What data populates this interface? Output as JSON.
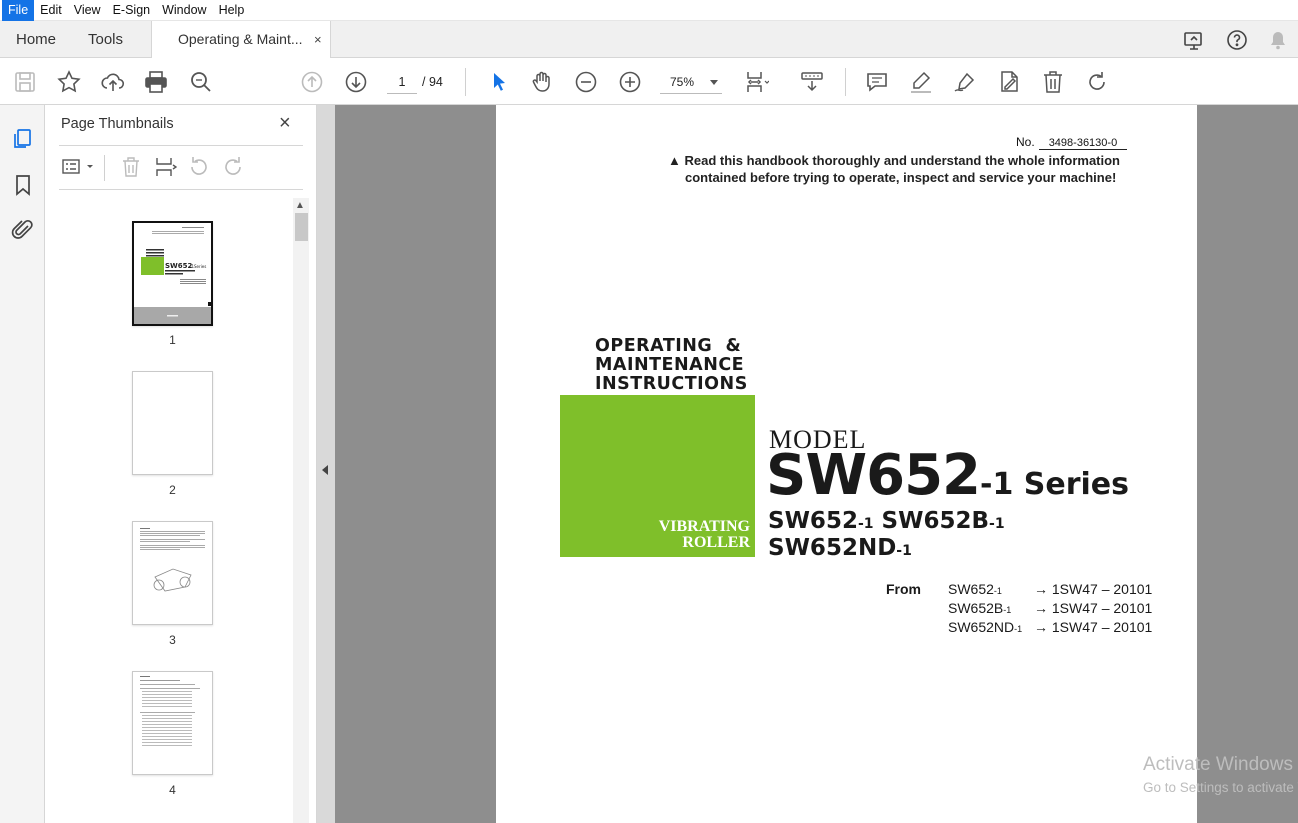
{
  "menu": {
    "items": [
      "File",
      "Edit",
      "View",
      "E-Sign",
      "Window",
      "Help"
    ]
  },
  "tabs": {
    "home": "Home",
    "tools": "Tools",
    "document": "Operating & Maint...",
    "close": "×"
  },
  "toolbar": {
    "current_page": "1",
    "page_of": "/  94",
    "zoom": "75%"
  },
  "panel": {
    "title": "Page Thumbnails",
    "close": "×",
    "thumbnails": [
      {
        "label": "1"
      },
      {
        "label": "2"
      },
      {
        "label": "3"
      },
      {
        "label": "4"
      }
    ]
  },
  "document": {
    "no_label": "No.",
    "no_value": "3498-36130-0",
    "warning_line1": "Read this handbook thoroughly and understand the whole information",
    "warning_line2": "contained before trying to operate, inspect and service your machine!",
    "heading_line1": "OPERATING  &",
    "heading_line2": "MAINTENANCE",
    "heading_line3": "INSTRUCTIONS",
    "green_line1": "VIBRATING",
    "green_line2": "ROLLER",
    "model_label": "MODEL",
    "model_big": "SW652",
    "model_suffix": "-1 Series",
    "sub_a": "SW652",
    "sub_a_suf": "-1",
    "sub_b": "SW652B",
    "sub_b_suf": "-1",
    "sub_c": "SW652ND",
    "sub_c_suf": "-1",
    "from_label": "From",
    "serials": [
      {
        "model": "SW652",
        "suf": "-1",
        "serial": "→ 1SW47 – 20101"
      },
      {
        "model": "SW652B",
        "suf": "-1",
        "serial": "→ 1SW47 – 20101"
      },
      {
        "model": "SW652ND",
        "suf": "-1",
        "serial": "→ 1SW47 – 20101"
      }
    ]
  },
  "watermark": {
    "line1": "Activate Windows",
    "line2": "Go to Settings to activate Windows."
  },
  "colors": {
    "accent": "#1473e6",
    "cover_green": "#7fbf2a",
    "doc_background": "#8e8e8e"
  }
}
